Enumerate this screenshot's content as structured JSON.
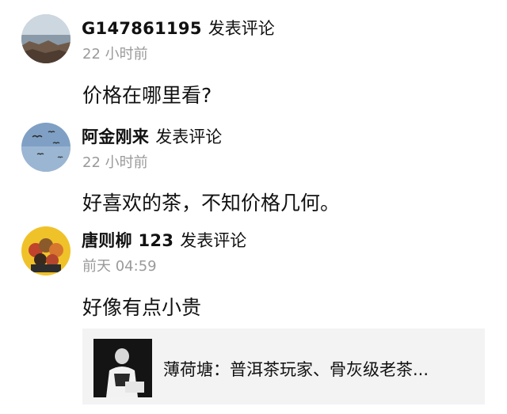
{
  "comments": [
    {
      "username": "G147861195",
      "action": "发表评论",
      "time": "22 小时前",
      "content": "价格在哪里看?",
      "avatar_icon": "seaside-rocks-avatar"
    },
    {
      "username": "阿金刚来",
      "action": "发表评论",
      "time": "22 小时前",
      "content": "好喜欢的茶，不知价格几何。",
      "avatar_icon": "sky-birds-avatar"
    },
    {
      "username": "唐则柳 123",
      "action": "发表评论",
      "time": "前天 04:59",
      "content": "好像有点小贵",
      "avatar_icon": "cartoon-group-avatar"
    }
  ],
  "shared_article": {
    "title": "薄荷塘：普洱茶玩家、骨灰级老茶...",
    "thumbnail_icon": "person-portrait-thumbnail"
  },
  "colors": {
    "text_primary": "#111111",
    "text_secondary": "#9a9a9a",
    "card_background": "#f3f3f3"
  }
}
